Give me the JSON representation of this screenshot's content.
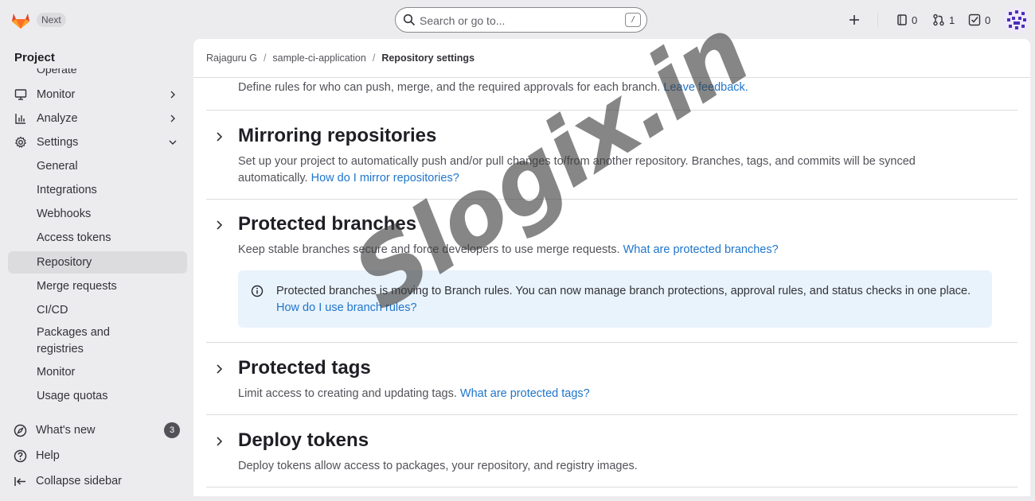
{
  "topbar": {
    "next_label": "Next",
    "search_placeholder": "Search or go to...",
    "search_shortcut": "/",
    "issues_count": "0",
    "merge_requests_count": "1",
    "todos_count": "0"
  },
  "sidebar": {
    "heading": "Project",
    "cut_item": "Operate",
    "items": [
      {
        "label": "Monitor",
        "icon": "monitor-icon"
      },
      {
        "label": "Analyze",
        "icon": "chart-icon"
      },
      {
        "label": "Settings",
        "icon": "gear-icon"
      }
    ],
    "settings_sub": [
      "General",
      "Integrations",
      "Webhooks",
      "Access tokens",
      "Repository",
      "Merge requests",
      "CI/CD",
      "Packages and registries",
      "Monitor",
      "Usage quotas"
    ],
    "active_sub": "Repository",
    "whats_new": "What's new",
    "whats_new_count": "3",
    "help": "Help",
    "collapse": "Collapse sidebar"
  },
  "breadcrumb": {
    "user": "Rajaguru G",
    "project": "sample-ci-application",
    "current": "Repository settings"
  },
  "content": {
    "prev_desc": "Define rules for who can push, merge, and the required approvals for each branch.",
    "prev_link": "Leave feedback.",
    "sections": [
      {
        "title": "Mirroring repositories",
        "desc": "Set up your project to automatically push and/or pull changes to/from another repository. Branches, tags, and commits will be synced automatically.",
        "link": "How do I mirror repositories?"
      },
      {
        "title": "Protected branches",
        "desc": "Keep stable branches secure and force developers to use merge requests.",
        "link": "What are protected branches?"
      },
      {
        "title": "Protected tags",
        "desc": "Limit access to creating and updating tags.",
        "link": "What are protected tags?"
      },
      {
        "title": "Deploy tokens",
        "desc": "Deploy tokens allow access to packages, your repository, and registry images.",
        "link": ""
      }
    ],
    "alert_text": "Protected branches is moving to Branch rules. You can now manage branch protections, approval rules, and status checks in one place.",
    "alert_link": "How do I use branch rules?"
  },
  "watermark": "Slogix.in",
  "colors": {
    "link": "#1f75cb",
    "alert_bg": "#e9f3fc",
    "active_bg": "#dcdcde",
    "logo": "#e24329"
  }
}
